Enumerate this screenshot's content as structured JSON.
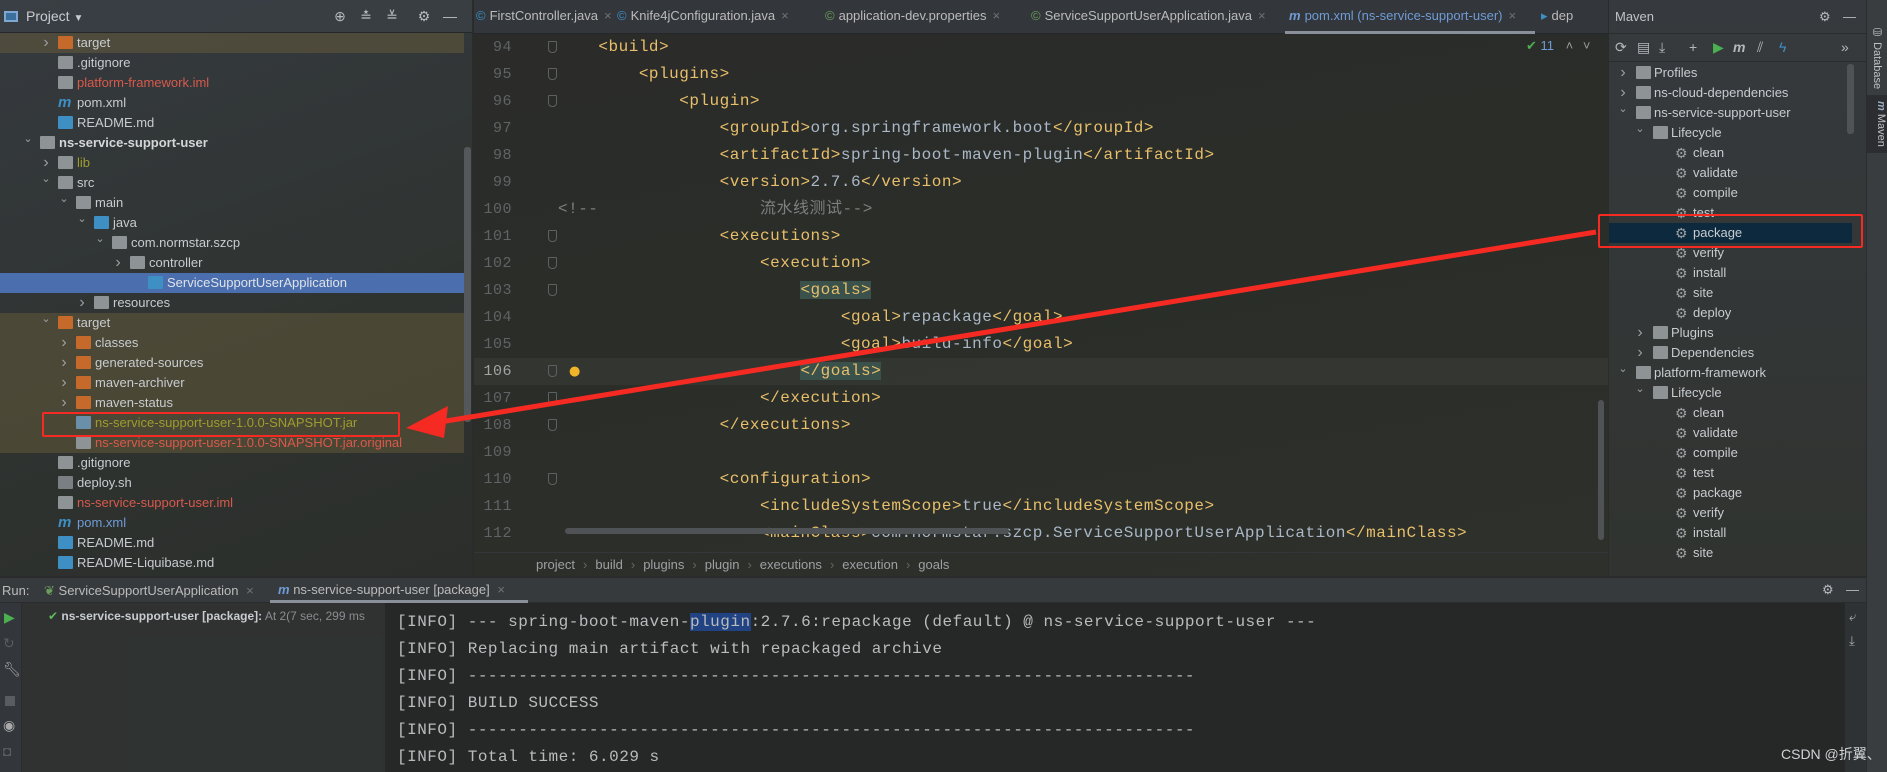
{
  "project": {
    "title": "Project",
    "tree": [
      {
        "label": "target",
        "level": 2,
        "chevron": ">",
        "icon": "folder-orange-icon",
        "color": "#c8ccd0",
        "excluded": true
      },
      {
        "label": ".gitignore",
        "level": 2,
        "chevron": "",
        "icon": "ignore-file-icon",
        "color": "#c8ccd0"
      },
      {
        "label": "platform-framework.iml",
        "level": 2,
        "chevron": "",
        "icon": "iml-file-icon",
        "color": "#d9594c"
      },
      {
        "label": "pom.xml",
        "level": 2,
        "chevron": "",
        "icon": "maven-icon",
        "color": "#c8ccd0"
      },
      {
        "label": "README.md",
        "level": 2,
        "chevron": "",
        "icon": "markdown-icon",
        "color": "#c8ccd0"
      },
      {
        "label": "ns-service-support-user",
        "level": 1,
        "chevron": "v",
        "icon": "module-folder-icon",
        "color": "#d4d6d8",
        "bold": true
      },
      {
        "label": "lib",
        "level": 2,
        "chevron": ">",
        "icon": "folder-icon",
        "color": "#9e9c2f"
      },
      {
        "label": "src",
        "level": 2,
        "chevron": "v",
        "icon": "folder-icon",
        "color": "#c8ccd0"
      },
      {
        "label": "main",
        "level": 3,
        "chevron": "v",
        "icon": "folder-icon",
        "color": "#c8ccd0"
      },
      {
        "label": "java",
        "level": 4,
        "chevron": "v",
        "icon": "source-folder-icon",
        "color": "#c8ccd0"
      },
      {
        "label": "com.normstar.szcp",
        "level": 5,
        "chevron": "v",
        "icon": "package-icon",
        "color": "#c8ccd0"
      },
      {
        "label": "controller",
        "level": 6,
        "chevron": ">",
        "icon": "package-icon",
        "color": "#c8ccd0"
      },
      {
        "label": "ServiceSupportUserApplication",
        "level": 7,
        "chevron": "",
        "icon": "spring-class-icon",
        "color": "#dfe3e8",
        "selected": true
      },
      {
        "label": "resources",
        "level": 4,
        "chevron": ">",
        "icon": "resources-folder-icon",
        "color": "#c8ccd0"
      },
      {
        "label": "target",
        "level": 2,
        "chevron": "v",
        "icon": "folder-orange-icon",
        "color": "#c8ccd0",
        "excluded": true
      },
      {
        "label": "classes",
        "level": 3,
        "chevron": ">",
        "icon": "folder-orange-icon",
        "color": "#c8ccd0",
        "excluded": true
      },
      {
        "label": "generated-sources",
        "level": 3,
        "chevron": ">",
        "icon": "folder-orange-icon",
        "color": "#c8ccd0",
        "excluded": true
      },
      {
        "label": "maven-archiver",
        "level": 3,
        "chevron": ">",
        "icon": "folder-orange-icon",
        "color": "#c8ccd0",
        "excluded": true
      },
      {
        "label": "maven-status",
        "level": 3,
        "chevron": ">",
        "icon": "folder-orange-icon",
        "color": "#c8ccd0",
        "excluded": true
      },
      {
        "label": "ns-service-support-user-1.0.0-SNAPSHOT.jar",
        "level": 3,
        "chevron": "",
        "icon": "jar-archive-icon",
        "color": "#9e9c2f",
        "excluded": true
      },
      {
        "label": "ns-service-support-user-1.0.0-SNAPSHOT.jar.original",
        "level": 3,
        "chevron": "",
        "icon": "unknown-file-icon",
        "color": "#d9594c",
        "excluded": true
      },
      {
        "label": ".gitignore",
        "level": 2,
        "chevron": "",
        "icon": "ignore-file-icon",
        "color": "#c8ccd0"
      },
      {
        "label": "deploy.sh",
        "level": 2,
        "chevron": "",
        "icon": "shell-script-icon",
        "color": "#c8ccd0"
      },
      {
        "label": "ns-service-support-user.iml",
        "level": 2,
        "chevron": "",
        "icon": "iml-file-icon",
        "color": "#d9594c"
      },
      {
        "label": "pom.xml",
        "level": 2,
        "chevron": "",
        "icon": "maven-icon",
        "color": "#6f9cd6"
      },
      {
        "label": "README.md",
        "level": 2,
        "chevron": "",
        "icon": "markdown-icon",
        "color": "#c8ccd0"
      },
      {
        "label": "README-Liquibase.md",
        "level": 2,
        "chevron": "",
        "icon": "markdown-icon",
        "color": "#c8ccd0"
      }
    ]
  },
  "editor": {
    "tabs": [
      {
        "label": "FirstController.java",
        "icon": "java-class-icon",
        "active": false,
        "close": "×"
      },
      {
        "label": "Knife4jConfiguration.java",
        "icon": "java-class-icon",
        "active": false,
        "close": "×"
      },
      {
        "label": "application-dev.properties",
        "icon": "spring-properties-icon",
        "active": false,
        "close": "×"
      },
      {
        "label": "ServiceSupportUserApplication.java",
        "icon": "spring-class-icon",
        "active": false,
        "close": "×"
      },
      {
        "label": "pom.xml (ns-service-support-user)",
        "icon": "maven-icon",
        "active": true,
        "close": "×"
      },
      {
        "label": "dep",
        "icon": "shell-script-icon",
        "active": false,
        "close": ""
      }
    ],
    "inspection_count": "11",
    "current_line": 106,
    "lines": [
      {
        "n": "94",
        "text": "    <build>",
        "fold": true
      },
      {
        "n": "95",
        "text": "        <plugins>",
        "fold": true
      },
      {
        "n": "96",
        "text": "            <plugin>",
        "fold": true
      },
      {
        "n": "97",
        "text": "                <groupId>org.springframework.boot</groupId>"
      },
      {
        "n": "98",
        "text": "                <artifactId>spring-boot-maven-plugin</artifactId>"
      },
      {
        "n": "99",
        "text": "                <version>2.7.6</version>"
      },
      {
        "n": "100",
        "text": "<!--                流水线测试-->",
        "comment": true
      },
      {
        "n": "101",
        "text": "                <executions>",
        "fold": true
      },
      {
        "n": "102",
        "text": "                    <execution>",
        "fold": true
      },
      {
        "n": "103",
        "text": "                        <goals>",
        "fold": true,
        "match": "<goals>"
      },
      {
        "n": "104",
        "text": "                            <goal>repackage</goal>"
      },
      {
        "n": "105",
        "text": "                            <goal>build-info</goal>"
      },
      {
        "n": "106",
        "text": "                        </goals>",
        "fold": true,
        "match": "</goals>",
        "bulb": true
      },
      {
        "n": "107",
        "text": "                    </execution>",
        "fold": true
      },
      {
        "n": "108",
        "text": "                </executions>",
        "fold": true
      },
      {
        "n": "109",
        "text": ""
      },
      {
        "n": "110",
        "text": "                <configuration>",
        "fold": true
      },
      {
        "n": "111",
        "text": "                    <includeSystemScope>true</includeSystemScope>"
      },
      {
        "n": "112",
        "text": "                    <mainClass>com.normstar.szcp.ServiceSupportUserApplication</mainClass>"
      }
    ],
    "breadcrumbs": [
      "project",
      "build",
      "plugins",
      "plugin",
      "executions",
      "execution",
      "goals"
    ]
  },
  "maven": {
    "title": "Maven",
    "toolbar": [
      "reload-icon",
      "generate-sources-icon",
      "download-icon",
      "add-icon",
      "run-icon",
      "execute-goal-icon",
      "skip-tests-icon",
      "offline-icon",
      "more-icon"
    ],
    "tree": [
      {
        "label": "Profiles",
        "level": 0,
        "chevron": ">",
        "icon": "profiles-icon"
      },
      {
        "label": "ns-cloud-dependencies",
        "level": 0,
        "chevron": ">",
        "icon": "maven-module-icon"
      },
      {
        "label": "ns-service-support-user",
        "level": 0,
        "chevron": "v",
        "icon": "maven-module-icon"
      },
      {
        "label": "Lifecycle",
        "level": 1,
        "chevron": "v",
        "icon": "lifecycle-folder-icon"
      },
      {
        "label": "clean",
        "level": 2,
        "icon": "gear-icon"
      },
      {
        "label": "validate",
        "level": 2,
        "icon": "gear-icon"
      },
      {
        "label": "compile",
        "level": 2,
        "icon": "gear-icon"
      },
      {
        "label": "test",
        "level": 2,
        "icon": "gear-icon"
      },
      {
        "label": "package",
        "level": 2,
        "icon": "gear-icon",
        "selected": true
      },
      {
        "label": "verify",
        "level": 2,
        "icon": "gear-icon"
      },
      {
        "label": "install",
        "level": 2,
        "icon": "gear-icon"
      },
      {
        "label": "site",
        "level": 2,
        "icon": "gear-icon"
      },
      {
        "label": "deploy",
        "level": 2,
        "icon": "gear-icon"
      },
      {
        "label": "Plugins",
        "level": 1,
        "chevron": ">",
        "icon": "plugins-folder-icon"
      },
      {
        "label": "Dependencies",
        "level": 1,
        "chevron": ">",
        "icon": "dependencies-icon"
      },
      {
        "label": "platform-framework",
        "level": 0,
        "chevron": "v",
        "icon": "maven-module-icon"
      },
      {
        "label": "Lifecycle",
        "level": 1,
        "chevron": "v",
        "icon": "lifecycle-folder-icon"
      },
      {
        "label": "clean",
        "level": 2,
        "icon": "gear-icon"
      },
      {
        "label": "validate",
        "level": 2,
        "icon": "gear-icon"
      },
      {
        "label": "compile",
        "level": 2,
        "icon": "gear-icon"
      },
      {
        "label": "test",
        "level": 2,
        "icon": "gear-icon"
      },
      {
        "label": "package",
        "level": 2,
        "icon": "gear-icon"
      },
      {
        "label": "verify",
        "level": 2,
        "icon": "gear-icon"
      },
      {
        "label": "install",
        "level": 2,
        "icon": "gear-icon"
      },
      {
        "label": "site",
        "level": 2,
        "icon": "gear-icon"
      },
      {
        "label": "deploy",
        "level": 2,
        "icon": "gear-icon"
      }
    ]
  },
  "side_strip": {
    "database": "Database",
    "maven": "Maven"
  },
  "run": {
    "label": "Run:",
    "tabs": [
      {
        "label": "ServiceSupportUserApplication",
        "active": false
      },
      {
        "label": "ns-service-support-user [package]",
        "active": true
      }
    ],
    "tree_item": {
      "name": "ns-service-support-user [package]:",
      "detail": "At 2(",
      "duration": "7 sec, 299 ms",
      "status": "success"
    },
    "console": [
      "[INFO] --- spring-boot-maven-plugin:2.7.6:repackage (default) @ ns-service-support-user ---",
      "[INFO] Replacing main artifact with repackaged archive",
      "[INFO] ------------------------------------------------------------------------",
      "[INFO] BUILD SUCCESS",
      "[INFO] ------------------------------------------------------------------------",
      "[INFO] Total time: 6.029 s"
    ],
    "console_selection": "plugin"
  },
  "watermark": "CSDN @折翼、",
  "colors": {
    "annotation": "#f52a22",
    "selection": "#4b6eaf",
    "maven_selection": "#0d293e",
    "xml_tag": "#e8bf6a",
    "xml_text": "#a9b7c6"
  }
}
